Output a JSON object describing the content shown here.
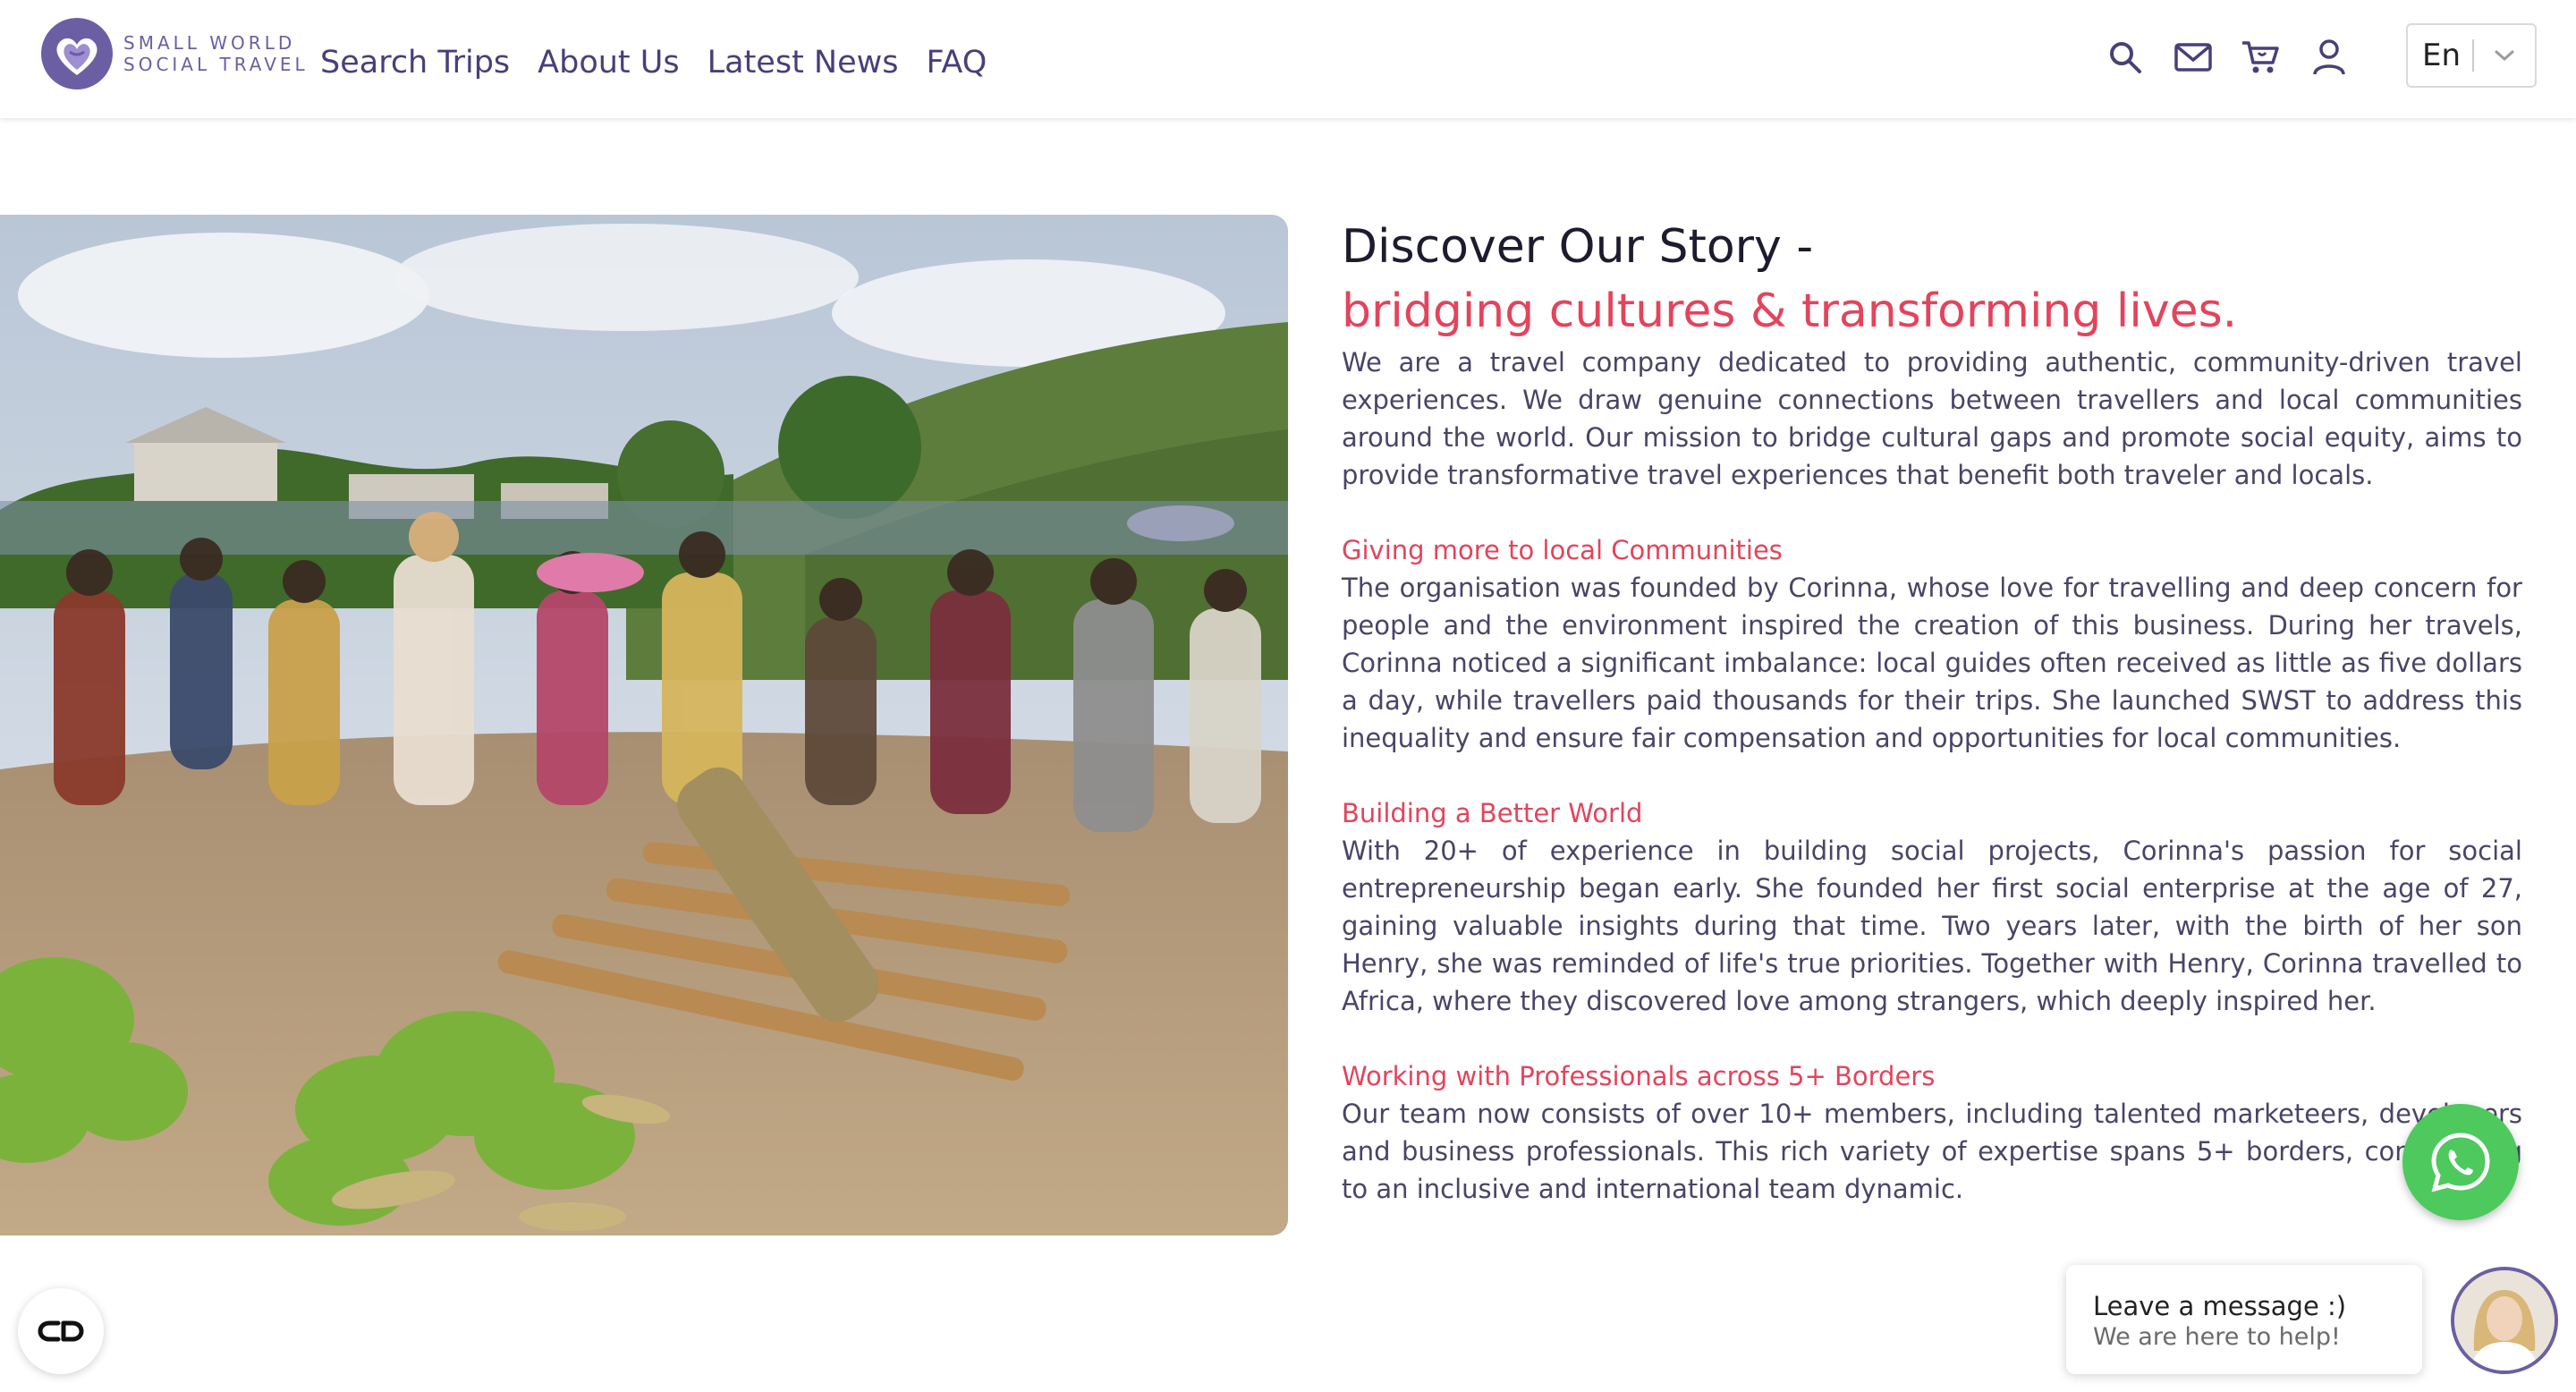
{
  "brand": {
    "name_line1": "SMALL WORLD",
    "name_line2": "SOCIAL TRAVEL",
    "logo_icon": "heart-globe-icon",
    "accent_color": "#6c5ea3"
  },
  "nav": {
    "items": [
      {
        "label": "Search Trips"
      },
      {
        "label": "About Us"
      },
      {
        "label": "Latest News"
      },
      {
        "label": "FAQ"
      }
    ]
  },
  "header_icons": [
    "search-icon",
    "mail-icon",
    "cart-icon",
    "user-icon"
  ],
  "language": {
    "selected": "En",
    "icon": "chevron-down-icon"
  },
  "hero_image": {
    "alt": "market scene"
  },
  "story": {
    "title": "Discover Our Story -",
    "subtitle": "bridging cultures & transforming lives.",
    "intro": "We are a travel company dedicated to providing authentic, community-driven travel experiences. We draw genuine connections between travellers and local communities around the world. Our mission to bridge cultural gaps and promote social equity, aims to provide transformative travel experiences that benefit both traveler and locals.",
    "sections": [
      {
        "heading": "Giving more to local Communities",
        "body": "The organisation was founded by Corinna, whose love for travelling and deep concern for people and the environment inspired the creation of this business. During her travels, Corinna noticed a significant imbalance: local guides often received as little as five dollars a day, while travellers paid thousands for their trips. She launched SWST to address this inequality and ensure fair compensation and opportunities for local communities."
      },
      {
        "heading": "Building a Better World",
        "body": "With 20+ of experience in building social projects, Corinna's passion for social entrepreneurship began early. She founded her first social enterprise at the age of 27, gaining valuable insights during that time. Two years later, with the birth of her son Henry, she was reminded of life's true priorities. Together with Henry, Corinna travelled to Africa, where they discovered love among strangers, which deeply inspired her."
      },
      {
        "heading": "Working with Professionals across 5+ Borders",
        "body": "Our team now consists of over 10+ members, including talented marketeers, developers and business professionals. This rich variety of expertise spans 5+ borders, contributing to an inclusive and international team dynamic."
      }
    ],
    "heading_color": "#e3445c"
  },
  "chat": {
    "title": "Leave a message :)",
    "subtitle": "We are here to help!",
    "whatsapp_icon": "whatsapp-icon",
    "whatsapp_color": "#4dc95d"
  },
  "accessibility": {
    "icon": "accessibility-icon"
  }
}
